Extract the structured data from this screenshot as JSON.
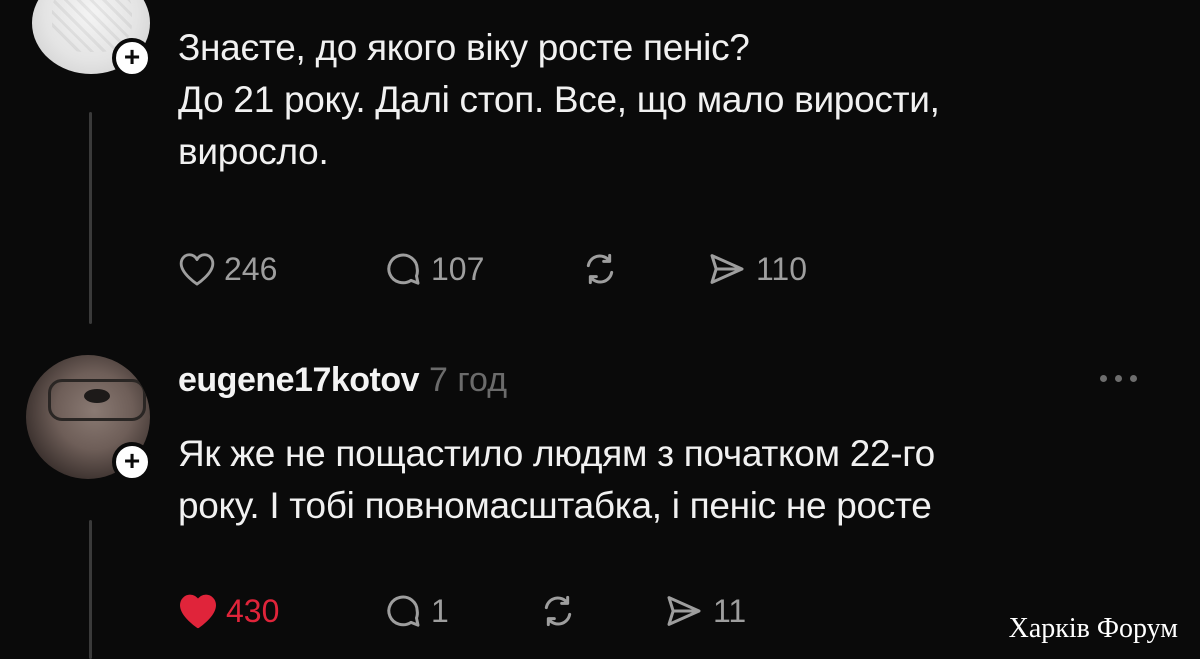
{
  "posts": [
    {
      "text": "Знаєте, до якого віку росте пеніс?\nДо 21 року. Далі стоп. Все, що мало вирости,\nвиросло.",
      "likes": "246",
      "comments": "107",
      "shares": "110",
      "liked": false
    },
    {
      "username": "eugene17kotov",
      "time": "7 год",
      "text": "Як же не пощастило людям з початком 22-го\nроку. І тобі повномасштабка, і пеніс не росте",
      "likes": "430",
      "comments": "1",
      "shares": "11",
      "liked": true
    }
  ],
  "follow_symbol": "+",
  "watermark": "Харків Форум",
  "colors": {
    "background": "#0a0a0a",
    "text": "#f1f1f1",
    "muted": "#9e9e9e",
    "like_active": "#e0243a"
  },
  "icons": [
    "heart-icon",
    "comment-icon",
    "repost-icon",
    "send-icon",
    "more-icon",
    "plus-icon"
  ]
}
